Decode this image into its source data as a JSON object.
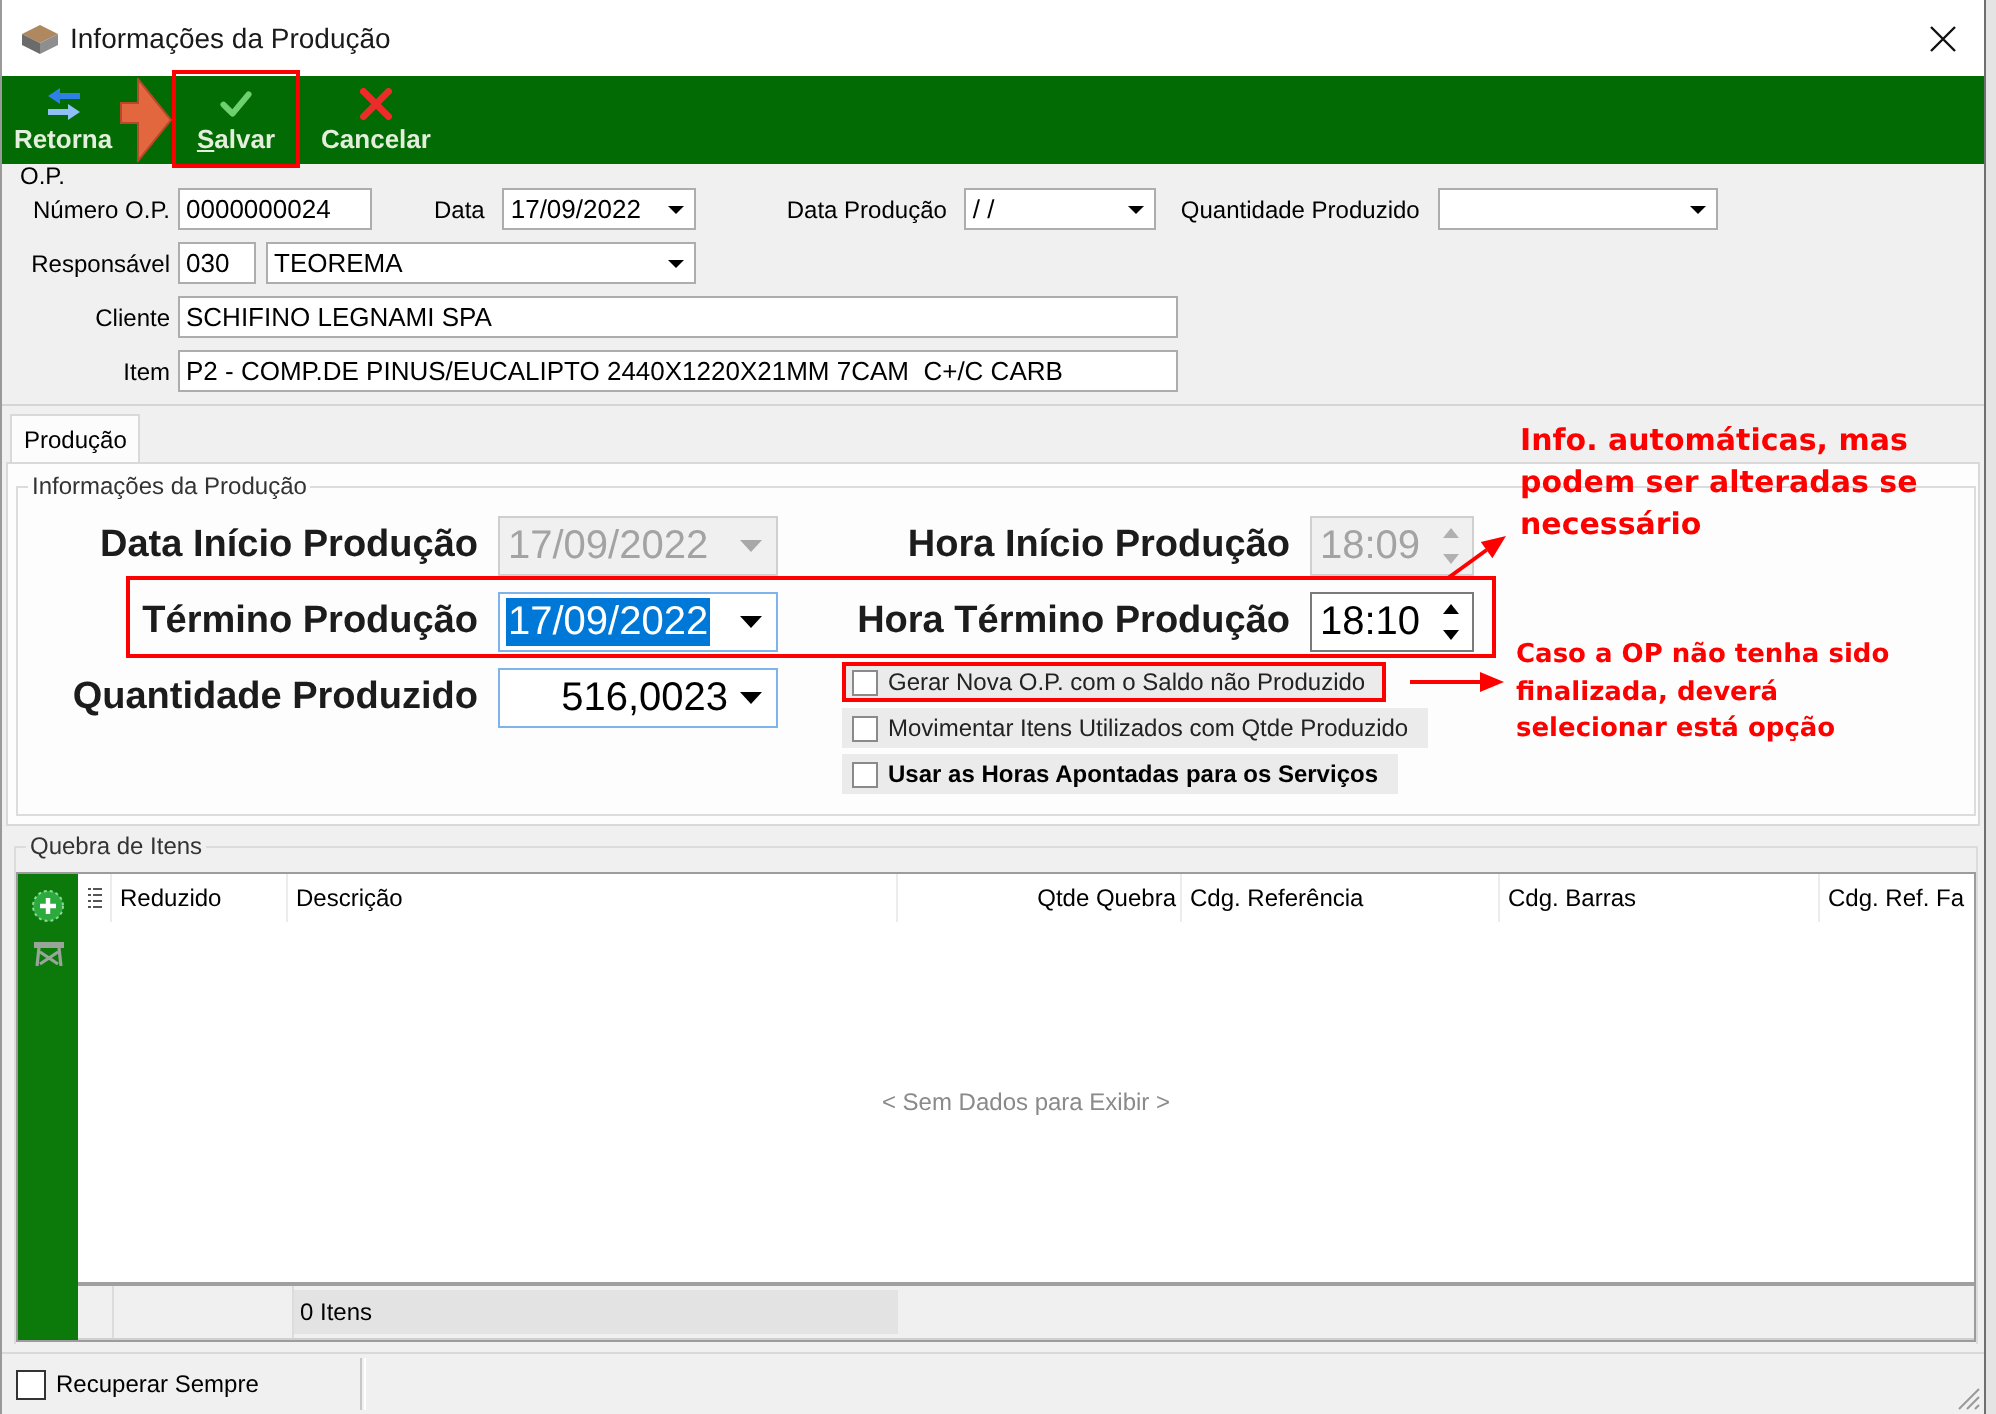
{
  "window": {
    "title": "Informações da Produção"
  },
  "toolbar": {
    "buttons": [
      {
        "label": "Retorna",
        "kind": "return",
        "highlighted": false
      },
      {
        "label": "Salvar",
        "kind": "save",
        "highlighted": true
      },
      {
        "label": "Cancelar",
        "kind": "cancel",
        "highlighted": false
      }
    ]
  },
  "op": {
    "legend": "O.P.",
    "number": {
      "label": "Número O.P.",
      "value": "0000000024"
    },
    "date": {
      "label": "Data",
      "value": "17/09/2022"
    },
    "production_date": {
      "label": "Data Produção",
      "value": "/ /"
    },
    "quantity": {
      "label": "Quantidade Produzido"
    },
    "responsible": {
      "label": "Responsável",
      "code": "030",
      "name": "TEOREMA"
    },
    "client": {
      "label": "Cliente",
      "value": "SCHIFINO LEGNAMI SPA"
    },
    "item": {
      "label": "Item",
      "value": "P2 - COMP.DE PINUS/EUCALIPTO 2440X1220X21MM 7CAM  C+/C CARB"
    }
  },
  "tabs": [
    {
      "label": "Produção",
      "selected": true
    }
  ],
  "production": {
    "legend": "Informações da Produção",
    "rows": [
      {
        "highlighted": false,
        "fields": [
          {
            "label": "Data Início Produção",
            "kind": "date",
            "value": "17/09/2022",
            "disabled": true,
            "focused": false,
            "value_selected": false
          },
          {
            "label": "Hora Início Produção",
            "kind": "time",
            "value": "18:09",
            "disabled": true,
            "focused": false,
            "value_selected": false
          }
        ]
      },
      {
        "highlighted": true,
        "fields": [
          {
            "label": "Término Produção",
            "kind": "date",
            "value": "17/09/2022",
            "disabled": false,
            "focused": true,
            "value_selected": true
          },
          {
            "label": "Hora Término Produção",
            "kind": "time",
            "value": "18:10",
            "disabled": false,
            "focused": false,
            "value_selected": false
          }
        ]
      },
      {
        "highlighted": false,
        "fields": [
          {
            "label": "Quantidade Produzido",
            "kind": "number",
            "value": "516,0023",
            "disabled": false,
            "focused": true,
            "value_selected": false
          }
        ]
      }
    ],
    "options": [
      {
        "label": "Gerar Nova O.P. com o Saldo não Produzido",
        "checked": false,
        "bold": false,
        "highlighted": true
      },
      {
        "label": "Movimentar Itens Utilizados com Qtde Produzido",
        "checked": false,
        "bold": false,
        "highlighted": false
      },
      {
        "label": "Usar as Horas Apontadas para os Serviços",
        "checked": false,
        "bold": true,
        "highlighted": false
      }
    ]
  },
  "breakdown": {
    "legend": "Quebra de Itens",
    "columns": [
      {
        "label": "Reduzido",
        "kind": "text"
      },
      {
        "label": "Descrição",
        "kind": "text"
      },
      {
        "label": "Qtde Quebra",
        "kind": "number"
      },
      {
        "label": "Cdg. Referência",
        "kind": "text"
      },
      {
        "label": "Cdg. Barras",
        "kind": "text"
      },
      {
        "label": "Cdg. Ref. Fa",
        "kind": "text"
      }
    ],
    "empty_text": "< Sem Dados para Exibir >",
    "footer_count": "0 Itens"
  },
  "status_bar": {
    "checkbox": {
      "label": "Recuperar Sempre",
      "checked": false
    }
  },
  "annotations": {
    "callouts": [
      {
        "text": "Info. automáticas, mas\npodem ser alteradas se\nnecessário"
      },
      {
        "text": "Caso a OP não tenha sido\nfinalizada, deverá\nselecionar está opção"
      }
    ]
  }
}
